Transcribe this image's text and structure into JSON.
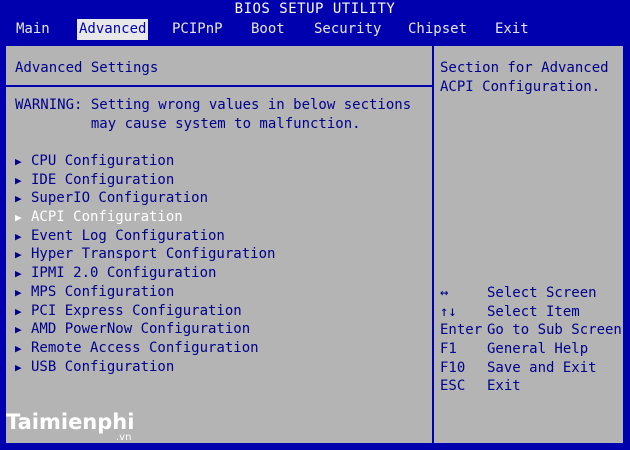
{
  "title": "BIOS SETUP UTILITY",
  "menu": [
    "Main",
    "Advanced",
    "PCIPnP",
    "Boot",
    "Security",
    "Chipset",
    "Exit"
  ],
  "active_menu": "Advanced",
  "left": {
    "heading": "Advanced Settings",
    "warning_line1": "WARNING: Setting wrong values in below sections",
    "warning_line2": "         may cause system to malfunction.",
    "items": [
      "CPU Configuration",
      "IDE Configuration",
      "SuperIO Configuration",
      "ACPI Configuration",
      "Event Log Configuration",
      "Hyper Transport Configuration",
      "IPMI 2.0 Configuration",
      "MPS Configuration",
      "PCI Express Configuration",
      "AMD PowerNow Configuration",
      "Remote Access Configuration",
      "USB Configuration"
    ],
    "selected_item": "ACPI Configuration"
  },
  "help": {
    "line1": "Section for Advanced",
    "line2": "ACPI Configuration."
  },
  "keys": [
    {
      "key": "↔",
      "action": "Select Screen"
    },
    {
      "key": "↑↓",
      "action": "Select Item"
    },
    {
      "key": "Enter",
      "action": "Go to Sub Screen"
    },
    {
      "key": "F1",
      "action": "General Help"
    },
    {
      "key": "F10",
      "action": "Save and Exit"
    },
    {
      "key": "ESC",
      "action": "Exit"
    }
  ],
  "watermark": {
    "brand": "Taimienphi",
    "suffix": ".vn"
  },
  "colors": {
    "background": "#0000ae",
    "panel": "#b4b4b4",
    "text": "#00008a",
    "highlight": "#ffffff"
  }
}
